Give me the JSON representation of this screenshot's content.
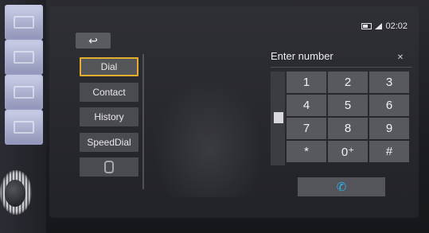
{
  "status_bar": {
    "time": "02:02"
  },
  "nav": {
    "back_symbol": "↩",
    "menu": [
      {
        "label": "Dial",
        "active": true
      },
      {
        "label": "Contact",
        "active": false
      },
      {
        "label": "History",
        "active": false
      },
      {
        "label": "SpeedDial",
        "active": false
      },
      {
        "label": "",
        "active": false
      }
    ]
  },
  "dialer": {
    "title": "Enter number",
    "clear_symbol": "✕",
    "keys": [
      [
        "1",
        "2",
        "3"
      ],
      [
        "4",
        "5",
        "6"
      ],
      [
        "7",
        "8",
        "9"
      ],
      [
        "*",
        "0⁺",
        "#"
      ]
    ],
    "call_symbol": "✆"
  },
  "colors": {
    "active_border": "#e4ad2c",
    "call_icon": "#2fb3ee",
    "key_bg": "#58595f"
  }
}
